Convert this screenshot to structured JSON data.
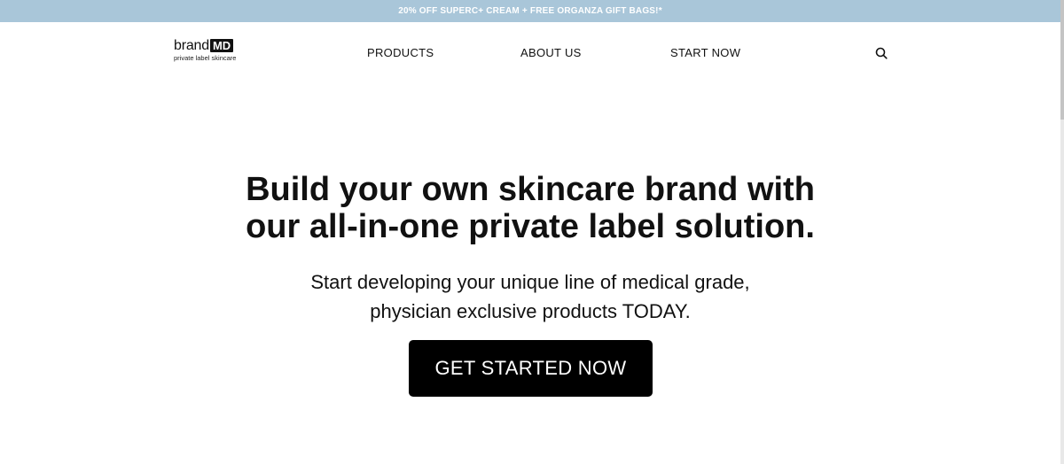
{
  "promo": {
    "text": "20% OFF SUPERC+ CREAM + FREE ORGANZA GIFT BAGS!*"
  },
  "colors": {
    "promo_bg": "#a9c6d9",
    "cta_bg": "#000000",
    "text": "#111111"
  },
  "logo": {
    "brand": "brand",
    "md": "MD",
    "tagline": "private label skincare"
  },
  "nav": {
    "products": "PRODUCTS",
    "about": "ABOUT US",
    "start": "START NOW"
  },
  "icons": {
    "search": "search-icon"
  },
  "hero": {
    "title_line1": "Build your own skincare brand with",
    "title_line2": "our all-in-one private label solution.",
    "subtitle_line1": "Start developing your unique line of medical grade,",
    "subtitle_line2": "physician exclusive products TODAY.",
    "cta": "GET STARTED NOW"
  }
}
